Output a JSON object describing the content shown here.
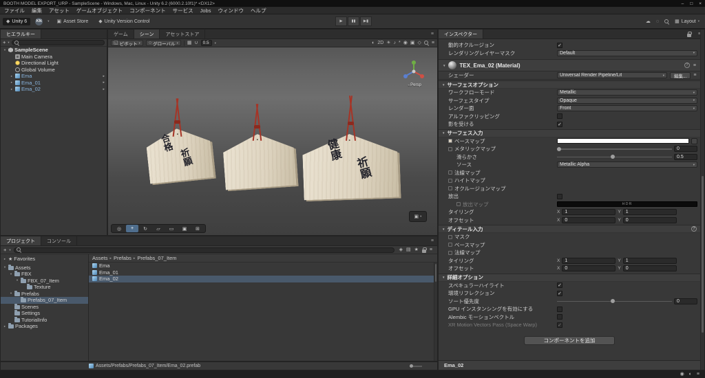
{
  "window": {
    "title": "BOOTH MODEL EXPORT_URP - SampleScene - Windows, Mac, Linux - Unity 6.2 (6000.2.10f1)* <DX12>"
  },
  "menu_bar": [
    "ファイル",
    "編集",
    "アセット",
    "ゲームオブジェクト",
    "コンポーネント",
    "サービス",
    "Jobs",
    "ウィンドウ",
    "ヘルプ"
  ],
  "toolbar": {
    "version_badge": "Unity 6",
    "account_initials": "KN",
    "asset_store": "Asset Store",
    "version_control": "Unity Version Control",
    "layout_label": "Layout",
    "right_icons": [
      "cloud-icon",
      "notifications-icon",
      "search-icon"
    ],
    "play_icons": [
      "play-icon",
      "pause-icon",
      "step-icon"
    ]
  },
  "hierarchy": {
    "tab": "ヒエラルキー",
    "add_button": "+",
    "scene_name": "SampleScene",
    "items": [
      {
        "label": "Main Camera",
        "icon": "camera"
      },
      {
        "label": "Directional Light",
        "icon": "light"
      },
      {
        "label": "Global Volume",
        "icon": "volume"
      },
      {
        "label": "Ema",
        "icon": "prefab",
        "expand": true,
        "prefab_arrow": true
      },
      {
        "label": "Ema_01",
        "icon": "prefab",
        "expand": true,
        "prefab_arrow": true
      },
      {
        "label": "Ema_02",
        "icon": "prefab",
        "expand": true,
        "prefab_arrow": true
      }
    ]
  },
  "scene": {
    "tabs": [
      {
        "label": "ゲーム"
      },
      {
        "label": "シーン",
        "active": true
      },
      {
        "label": "アセットストア"
      }
    ],
    "pivot_label": "ピボット",
    "global_label": "グローバル",
    "snap_value": "0.5",
    "persp_label": "Persp",
    "toolbar_left_icons": [
      "grid-snap-icon",
      "magnet-icon"
    ],
    "toolbar_right_icons": [
      "shaded-mode-icon",
      "twod-icon",
      "lighting-icon",
      "audio-icon",
      "effects-icon",
      "visibility-icon",
      "camera-count-icon",
      "gizmos-icon",
      "search-icon",
      "menu-icon"
    ],
    "tool_icons": [
      "view-tool-icon",
      "move-tool-icon",
      "rotate-tool-icon",
      "scale-tool-icon",
      "rect-tool-icon",
      "transform-tool-icon",
      "custom-tool-icon"
    ],
    "plaques": [
      {
        "columns": [
          "合格",
          "祈願"
        ]
      },
      {
        "columns": []
      },
      {
        "columns": [
          "健康",
          "祈願"
        ]
      }
    ]
  },
  "project": {
    "tabs": [
      {
        "label": "プロジェクト",
        "active": true
      },
      {
        "label": "コンソール"
      }
    ],
    "add_button": "+",
    "toolbar_icons": [
      "search-type-icon",
      "label-icon",
      "favorite-icon",
      "lock-icon",
      "menu-icon"
    ],
    "tree": [
      {
        "label": "Favorites",
        "depth": 0,
        "icon": "star",
        "arrow": "▸"
      },
      {
        "label": "Assets",
        "depth": 0,
        "icon": "folder-open",
        "arrow": "▾"
      },
      {
        "label": "FBX",
        "depth": 1,
        "icon": "folder-open",
        "arrow": "▾"
      },
      {
        "label": "FBX_07_Item",
        "depth": 2,
        "icon": "folder-open",
        "arrow": "▾"
      },
      {
        "label": "Texture",
        "depth": 3,
        "icon": "folder"
      },
      {
        "label": "Prefabs",
        "depth": 1,
        "icon": "folder-open",
        "arrow": "▾"
      },
      {
        "label": "Prefabs_07_Item",
        "depth": 2,
        "icon": "folder",
        "selected": true
      },
      {
        "label": "Scenes",
        "depth": 1,
        "icon": "folder"
      },
      {
        "label": "Settings",
        "depth": 1,
        "icon": "folder"
      },
      {
        "label": "TutorialInfo",
        "depth": 1,
        "icon": "folder"
      },
      {
        "label": "Packages",
        "depth": 0,
        "icon": "folder",
        "arrow": "▸"
      }
    ],
    "breadcrumb": [
      "Assets",
      "Prefabs",
      "Prefabs_07_Item"
    ],
    "files": [
      {
        "label": "Ema"
      },
      {
        "label": "Ema_01"
      },
      {
        "label": "Ema_02",
        "selected": true
      }
    ],
    "status_path": "Assets/Prefabs/Prefabs_07_Item/Ema_02.prefab"
  },
  "inspector": {
    "tab": "インスペクター",
    "top_rows": [
      {
        "label": "動的オクルージョン",
        "type": "checkbox",
        "checked": true
      },
      {
        "label": "レンダリングレイヤーマスク",
        "type": "dropdown",
        "value": "Default"
      }
    ],
    "material_title": "TEX_Ema_02 (Material)",
    "shader_label": "シェーダー",
    "shader_value": "Universal Render Pipeline/Lit",
    "edit_button": "編集...",
    "sections": [
      {
        "title": "サーフェスオプション",
        "rows": [
          {
            "label": "ワークフローモード",
            "type": "dropdown",
            "value": "Metallic"
          },
          {
            "label": "サーフェスタイプ",
            "type": "dropdown",
            "value": "Opaque"
          },
          {
            "label": "レンダー面",
            "type": "dropdown",
            "value": "Front"
          },
          {
            "label": "アルファクリッピング",
            "type": "checkbox",
            "checked": false
          },
          {
            "label": "影を受ける",
            "type": "checkbox",
            "checked": true
          }
        ]
      },
      {
        "title": "サーフェス入力",
        "rows": [
          {
            "label": "ベースマップ",
            "type": "color",
            "value": "#ffffff",
            "texslot": true,
            "thumb": "#d8cfc0"
          },
          {
            "label": "メタリックマップ",
            "type": "slider",
            "value": 0,
            "display": "0",
            "texslot": true
          },
          {
            "label": "滑らかさ",
            "type": "slider",
            "value": 0.5,
            "display": "0.5",
            "indent": true
          },
          {
            "label": "ソース",
            "type": "dropdown",
            "value": "Metallic Alpha",
            "indent": true
          },
          {
            "label": "法線マップ",
            "type": "none",
            "texslot": true
          },
          {
            "label": "ハイトマップ",
            "type": "none",
            "texslot": true
          },
          {
            "label": "オクルージョンマップ",
            "type": "none",
            "texslot": true
          },
          {
            "label": "放出",
            "type": "checkbox",
            "checked": false
          },
          {
            "label": "放出マップ",
            "type": "hdr",
            "value": "HDR",
            "texslot": true,
            "disabled": true,
            "indent": true
          },
          {
            "label": "タイリング",
            "type": "vec2",
            "x": "1",
            "y": "1"
          },
          {
            "label": "オフセット",
            "type": "vec2",
            "x": "0",
            "y": "0"
          }
        ]
      },
      {
        "title": "ディテール入力",
        "info": true,
        "rows": [
          {
            "label": "マスク",
            "type": "none",
            "texslot": true
          },
          {
            "label": "ベースマップ",
            "type": "none",
            "texslot": true
          },
          {
            "label": "法線マップ",
            "type": "none",
            "texslot": true
          },
          {
            "label": "タイリング",
            "type": "vec2",
            "x": "1",
            "y": "1"
          },
          {
            "label": "オフセット",
            "type": "vec2",
            "x": "0",
            "y": "0"
          }
        ]
      },
      {
        "title": "詳細オプション",
        "rows": [
          {
            "label": "スペキュラーハイライト",
            "type": "checkbox",
            "checked": true
          },
          {
            "label": "環境リフレクション",
            "type": "checkbox",
            "checked": true
          },
          {
            "label": "ソート優先度",
            "type": "slider",
            "value": 0.5,
            "display": "0"
          },
          {
            "label": "GPU インスタンシングを有効にする",
            "type": "checkbox",
            "checked": false
          },
          {
            "label": "Alembic モーションベクトル",
            "type": "checkbox",
            "checked": false
          },
          {
            "label": "XR Motion Vectors Pass (Space Warp)",
            "type": "checkbox",
            "checked": true,
            "disabled": true
          }
        ]
      }
    ],
    "add_component": "コンポーネントを追加",
    "footer_title": "Ema_02"
  },
  "status_icons": [
    "cache-server-icon",
    "progress-icon",
    "status-menu-icon"
  ]
}
